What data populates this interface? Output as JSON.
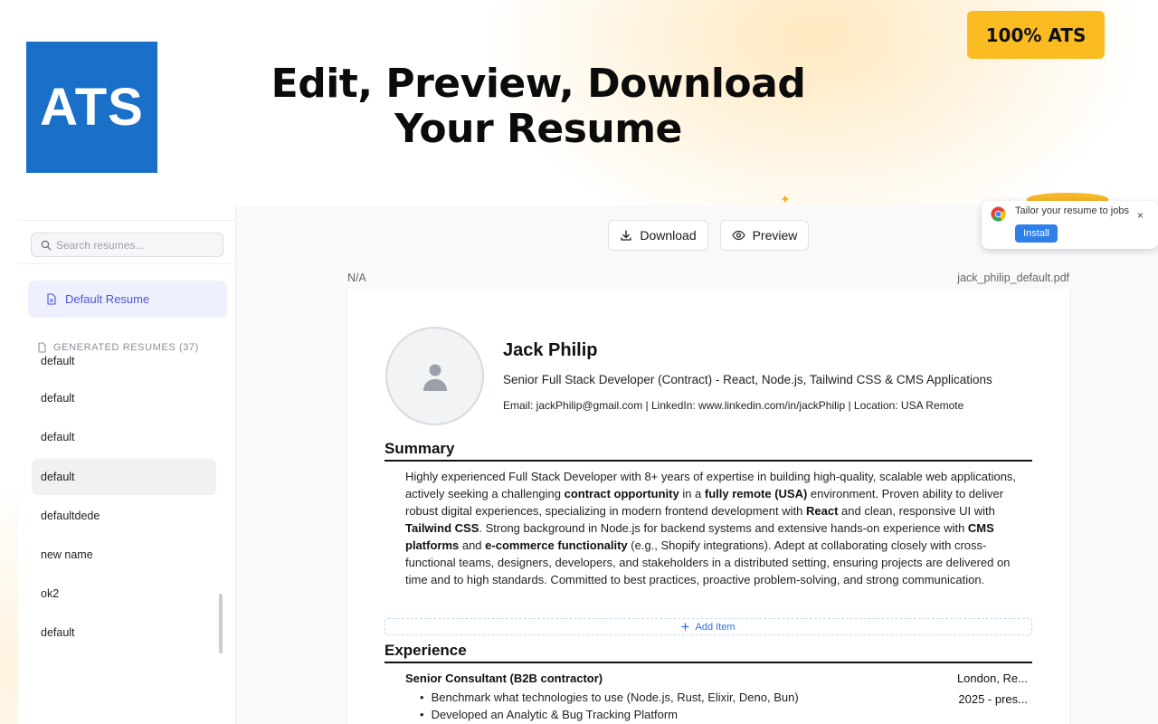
{
  "promo": {
    "logo_text": "ATS",
    "headline_line1": "Edit, Preview, Download",
    "headline_line2": "Your Resume",
    "badge": "100% ATS"
  },
  "sidebar": {
    "search_placeholder": "Search resumes...",
    "default_resume_label": "Default Resume",
    "generated_header": "GENERATED RESUMES (37)",
    "items": [
      {
        "label": "default"
      },
      {
        "label": "default"
      },
      {
        "label": "default"
      },
      {
        "label": "default"
      },
      {
        "label": "defaultdede"
      },
      {
        "label": "new name"
      },
      {
        "label": "ok2"
      },
      {
        "label": "default"
      }
    ]
  },
  "toolbar": {
    "download_label": "Download",
    "preview_label": "Preview"
  },
  "document": {
    "meta_left": "N/A",
    "meta_right": "jack_philip_default.pdf"
  },
  "resume": {
    "name": "Jack Philip",
    "title": "Senior Full Stack Developer (Contract) - React, Node.js, Tailwind CSS & CMS Applications",
    "contact": "Email: jackPhilip@gmail.com | LinkedIn: www.linkedin.com/in/jackPhilip | Location: USA Remote",
    "summary_heading": "Summary",
    "summary": {
      "p1": "Highly experienced Full Stack Developer with 8+ years of expertise in building high-quality, scalable web applications, actively seeking a challenging ",
      "b1": "contract opportunity",
      "p2": " in a ",
      "b2": "fully remote (USA)",
      "p3": " environment. Proven ability to deliver robust digital experiences, specializing in modern frontend development with ",
      "b3": "React",
      "p4": " and clean, responsive UI with ",
      "b4": "Tailwind CSS",
      "p5": ". Strong background in Node.js for backend systems and extensive hands-on experience with ",
      "b5": "CMS platforms",
      "p6": " and ",
      "b6": "e-commerce functionality",
      "p7": " (e.g., Shopify integrations). Adept at collaborating closely with cross-functional teams, designers, developers, and stakeholders in a distributed setting, ensuring projects are delivered on time and to high standards. Committed to best practices, proactive problem-solving, and strong communication."
    },
    "add_item_label": "Add Item",
    "experience_heading": "Experience",
    "job": {
      "role": "Senior Consultant (B2B contractor)",
      "location": "London, Re...",
      "dates": "2025 - pres...",
      "bullets": [
        "Benchmark what technologies to use (Node.js, Rust, Elixir, Deno, Bun)",
        "Developed an Analytic & Bug Tracking Platform"
      ]
    }
  },
  "install_popup": {
    "text": "Tailor your resume to jobs",
    "install_label": "Install",
    "close_glyph": "×"
  }
}
